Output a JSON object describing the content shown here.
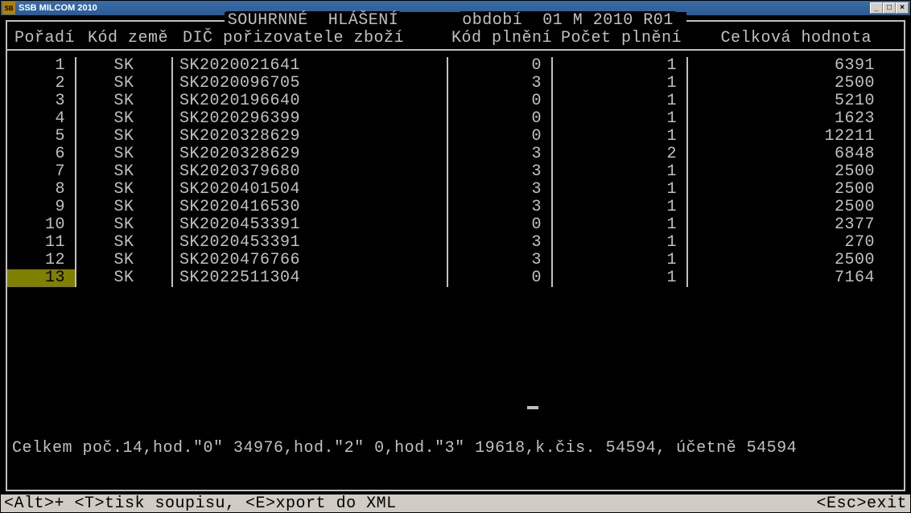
{
  "window": {
    "title": "SSB MILCOM 2010",
    "icon_label": "SB"
  },
  "header": {
    "title_left": "SOUHRNNÉ  HLÁŠENÍ",
    "title_right": "období  01 M 2010 R01",
    "cols": {
      "poradi": "Pořadí",
      "zeme": "Kód země",
      "dic": "DIČ pořizovatele zboží",
      "kod": "Kód plnění",
      "pocet": "Počet plnění",
      "hodnota": "Celková hodnota"
    }
  },
  "rows": [
    {
      "poradi": "1",
      "zeme": "SK",
      "dic": "SK2020021641",
      "kod": "0",
      "pocet": "1",
      "hodnota": "6391"
    },
    {
      "poradi": "2",
      "zeme": "SK",
      "dic": "SK2020096705",
      "kod": "3",
      "pocet": "1",
      "hodnota": "2500"
    },
    {
      "poradi": "3",
      "zeme": "SK",
      "dic": "SK2020196640",
      "kod": "0",
      "pocet": "1",
      "hodnota": "5210"
    },
    {
      "poradi": "4",
      "zeme": "SK",
      "dic": "SK2020296399",
      "kod": "0",
      "pocet": "1",
      "hodnota": "1623"
    },
    {
      "poradi": "5",
      "zeme": "SK",
      "dic": "SK2020328629",
      "kod": "0",
      "pocet": "1",
      "hodnota": "12211"
    },
    {
      "poradi": "6",
      "zeme": "SK",
      "dic": "SK2020328629",
      "kod": "3",
      "pocet": "2",
      "hodnota": "6848"
    },
    {
      "poradi": "7",
      "zeme": "SK",
      "dic": "SK2020379680",
      "kod": "3",
      "pocet": "1",
      "hodnota": "2500"
    },
    {
      "poradi": "8",
      "zeme": "SK",
      "dic": "SK2020401504",
      "kod": "3",
      "pocet": "1",
      "hodnota": "2500"
    },
    {
      "poradi": "9",
      "zeme": "SK",
      "dic": "SK2020416530",
      "kod": "3",
      "pocet": "1",
      "hodnota": "2500"
    },
    {
      "poradi": "10",
      "zeme": "SK",
      "dic": "SK2020453391",
      "kod": "0",
      "pocet": "1",
      "hodnota": "2377"
    },
    {
      "poradi": "11",
      "zeme": "SK",
      "dic": "SK2020453391",
      "kod": "3",
      "pocet": "1",
      "hodnota": "270"
    },
    {
      "poradi": "12",
      "zeme": "SK",
      "dic": "SK2020476766",
      "kod": "3",
      "pocet": "1",
      "hodnota": "2500"
    },
    {
      "poradi": "13",
      "zeme": "SK",
      "dic": "SK2022511304",
      "kod": "0",
      "pocet": "1",
      "hodnota": "7164"
    }
  ],
  "selected_index": 12,
  "summary": "Celkem poč.14,hod.\"0\" 34976,hod.\"2\" 0,hod.\"3\" 19618,k.čis. 54594, účetně 54594",
  "status": {
    "left": "<Alt>+ <T>tisk soupisu, <E>xport do XML",
    "right": "<Esc>exit"
  }
}
